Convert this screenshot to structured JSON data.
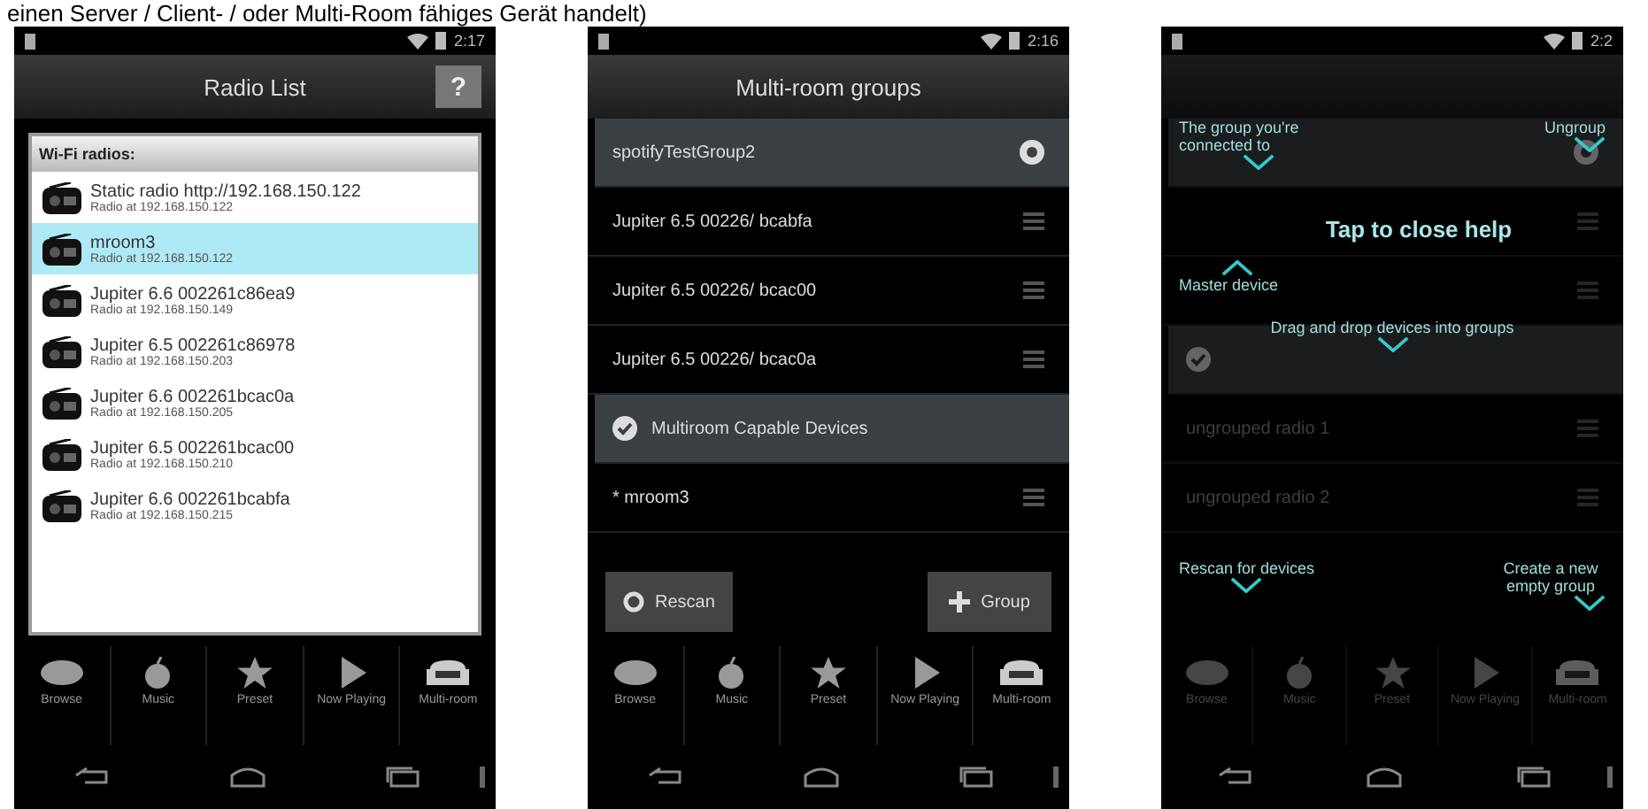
{
  "caption": "einen Server / Client- / oder Multi-Room fähiges Gerät handelt)",
  "phones": [
    {
      "kind": "radio_list",
      "status_time": "2:17",
      "title": "Radio List",
      "help_button": "?",
      "list_header": "Wi-Fi radios:",
      "radios": [
        {
          "name": "Static radio http://192.168.150.122",
          "address": "Radio at 192.168.150.122",
          "selected": false
        },
        {
          "name": "mroom3",
          "address": "Radio at 192.168.150.122",
          "selected": true
        },
        {
          "name": "Jupiter 6.6 002261c86ea9",
          "address": "Radio at 192.168.150.149",
          "selected": false
        },
        {
          "name": "Jupiter 6.5 002261c86978",
          "address": "Radio at 192.168.150.203",
          "selected": false
        },
        {
          "name": "Jupiter 6.6 002261bcac0a",
          "address": "Radio at 192.168.150.205",
          "selected": false
        },
        {
          "name": "Jupiter 6.5 002261bcac00",
          "address": "Radio at 192.168.150.210",
          "selected": false
        },
        {
          "name": "Jupiter 6.6 002261bcabfa",
          "address": "Radio at 192.168.150.215",
          "selected": false
        }
      ],
      "tabs": [
        {
          "label": "Browse"
        },
        {
          "label": "Music"
        },
        {
          "label": "Preset"
        },
        {
          "label": "Now Playing"
        },
        {
          "label": "Multi-room"
        }
      ]
    },
    {
      "kind": "groups",
      "status_time": "2:16",
      "title": "Multi-room groups",
      "rows": [
        {
          "kind": "group",
          "text": "spotifyTestGroup2"
        },
        {
          "kind": "device",
          "text": "Jupiter 6.5 00226/ bcabfa"
        },
        {
          "kind": "device",
          "text": "Jupiter 6.5 00226/ bcac00"
        },
        {
          "kind": "device",
          "text": "Jupiter 6.5 00226/ bcac0a"
        },
        {
          "kind": "section",
          "text": "Multiroom Capable Devices"
        },
        {
          "kind": "device",
          "text": "* mroom3"
        }
      ],
      "buttons": [
        {
          "kind": "rescan",
          "label": "Rescan"
        },
        {
          "kind": "add",
          "label": "Group"
        }
      ],
      "tabs": [
        {
          "label": "Browse"
        },
        {
          "label": "Music"
        },
        {
          "label": "Preset"
        },
        {
          "label": "Now Playing"
        },
        {
          "label": "Multi-room"
        }
      ]
    },
    {
      "kind": "help",
      "status_time": "2:2",
      "rows": [
        {
          "kind": "group",
          "text": ""
        },
        {
          "kind": "device",
          "text": ""
        },
        {
          "kind": "device",
          "text": ""
        },
        {
          "kind": "section",
          "text": ""
        },
        {
          "kind": "device",
          "text": "ungrouped radio 1"
        },
        {
          "kind": "device",
          "text": "ungrouped radio 2"
        }
      ],
      "help": {
        "top_left": "The group you're connected to",
        "top_right": "Ungroup",
        "close": "Tap to close help",
        "master": "Master device",
        "drag": "Drag and drop devices into groups",
        "bottom_left": "Rescan for devices",
        "bottom_right": "Create a new empty group"
      },
      "tabs": [
        {
          "label": "Browse"
        },
        {
          "label": "Music"
        },
        {
          "label": "Preset"
        },
        {
          "label": "Now Playing"
        },
        {
          "label": "Multi-room"
        }
      ]
    }
  ]
}
